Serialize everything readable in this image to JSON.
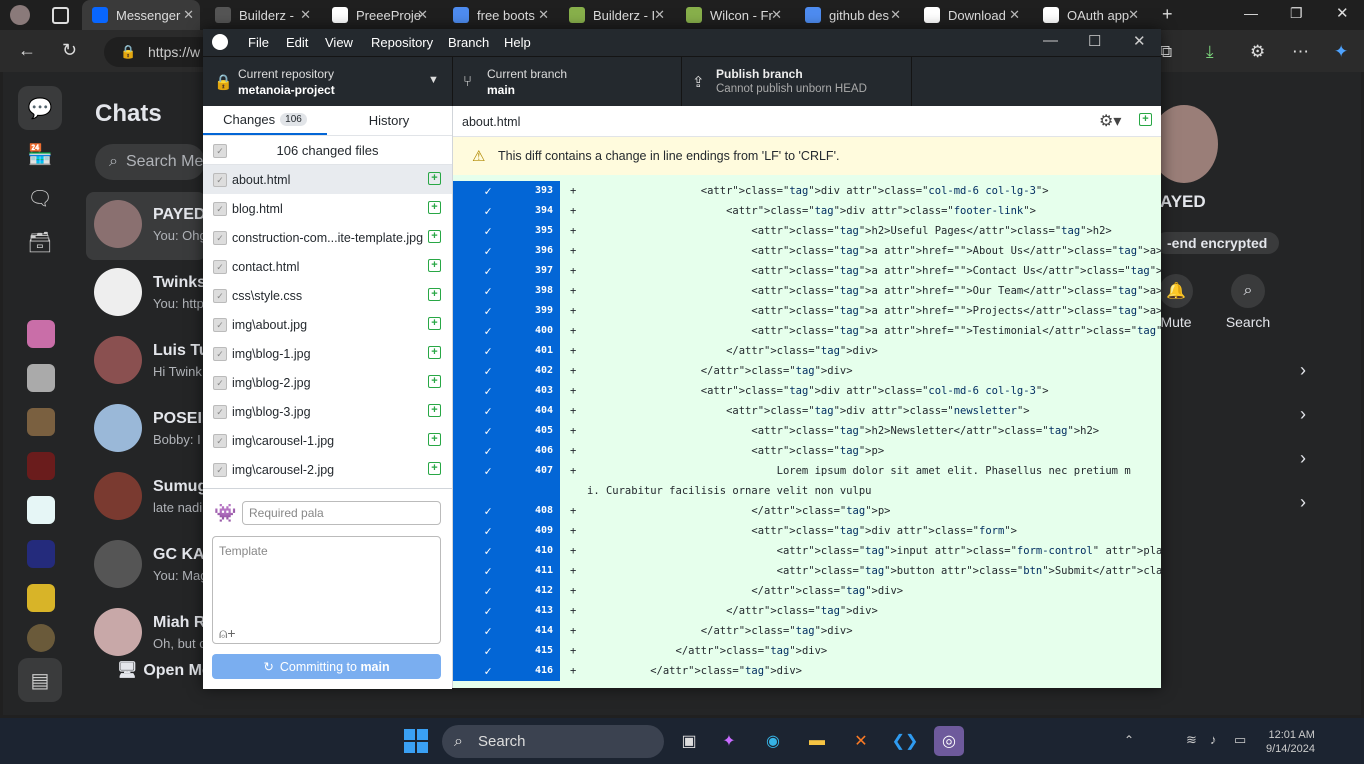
{
  "browser": {
    "tabs": [
      {
        "label": "Messenger",
        "active": true
      },
      {
        "label": "Builderz - "
      },
      {
        "label": "PreeeProje"
      },
      {
        "label": "free boots"
      },
      {
        "label": "Builderz - I"
      },
      {
        "label": "Wilcon - Fr"
      },
      {
        "label": "github des"
      },
      {
        "label": "Download"
      },
      {
        "label": "OAuth app"
      }
    ],
    "url": "https://w"
  },
  "messenger": {
    "title": "Chats",
    "search_placeholder": "Search Me",
    "chats": [
      {
        "name": "PAYED",
        "preview": "You: Ohg"
      },
      {
        "name": "Twinks",
        "preview": "You: http"
      },
      {
        "name": "Luis Tup",
        "preview": "Hi Twink"
      },
      {
        "name": "POSEID",
        "preview": "Bobby: I"
      },
      {
        "name": "Sumuga",
        "preview": "late nadi"
      },
      {
        "name": "GC KA S",
        "preview": "You: Mag"
      },
      {
        "name": "Miah Ra",
        "preview": "Oh, but c"
      }
    ],
    "open_label": "Open Me",
    "right_name": "AYED",
    "right_encrypted": "-end encrypted",
    "right_actions": [
      "Mute",
      "Search"
    ]
  },
  "ghd": {
    "menu": [
      "File",
      "Edit",
      "View",
      "Repository",
      "Branch",
      "Help"
    ],
    "repo_label": "Current repository",
    "repo_value": "metanoia-project",
    "branch_label": "Current branch",
    "branch_value": "main",
    "publish_label": "Publish branch",
    "publish_sub": "Cannot publish unborn HEAD",
    "tab_changes": "Changes",
    "tab_changes_count": "106",
    "tab_history": "History",
    "changed_files_label": "106 changed files",
    "files": [
      "about.html",
      "blog.html",
      "construction-com...ite-template.jpg",
      "contact.html",
      "css\\style.css",
      "img\\about.jpg",
      "img\\blog-1.jpg",
      "img\\blog-2.jpg",
      "img\\blog-3.jpg",
      "img\\carousel-1.jpg",
      "img\\carousel-2.jpg"
    ],
    "summary_placeholder": "Required pala",
    "description_placeholder": "Template",
    "commit_label": "Committing to",
    "commit_branch": "main",
    "diff_file": "about.html",
    "warning": "This diff contains a change in line endings from 'LF' to 'CRLF'.",
    "diff_lines": [
      {
        "n": "393",
        "code": "                  <div class=\"col-md-6 col-lg-3\">"
      },
      {
        "n": "394",
        "code": "                      <div class=\"footer-link\">"
      },
      {
        "n": "395",
        "code": "                          <h2>Useful Pages</h2>"
      },
      {
        "n": "396",
        "code": "                          <a href=\"\">About Us</a>"
      },
      {
        "n": "397",
        "code": "                          <a href=\"\">Contact Us</a>"
      },
      {
        "n": "398",
        "code": "                          <a href=\"\">Our Team</a>"
      },
      {
        "n": "399",
        "code": "                          <a href=\"\">Projects</a>"
      },
      {
        "n": "400",
        "code": "                          <a href=\"\">Testimonial</a>"
      },
      {
        "n": "401",
        "code": "                      </div>"
      },
      {
        "n": "402",
        "code": "                  </div>"
      },
      {
        "n": "403",
        "code": "                  <div class=\"col-md-6 col-lg-3\">"
      },
      {
        "n": "404",
        "code": "                      <div class=\"newsletter\">"
      },
      {
        "n": "405",
        "code": "                          <h2>Newsletter</h2>"
      },
      {
        "n": "406",
        "code": "                          <p>"
      },
      {
        "n": "407",
        "code": "                              Lorem ipsum dolor sit amet elit. Phasellus nec pretium m"
      },
      {
        "n": "",
        "code": "i. Curabitur facilisis ornare velit non vulpu",
        "wrap": true
      },
      {
        "n": "408",
        "code": "                          </p>"
      },
      {
        "n": "409",
        "code": "                          <div class=\"form\">"
      },
      {
        "n": "410",
        "code": "                              <input class=\"form-control\" placeholder=\"Email here\">"
      },
      {
        "n": "411",
        "code": "                              <button class=\"btn\">Submit</button>"
      },
      {
        "n": "412",
        "code": "                          </div>"
      },
      {
        "n": "413",
        "code": "                      </div>"
      },
      {
        "n": "414",
        "code": "                  </div>"
      },
      {
        "n": "415",
        "code": "              </div>"
      },
      {
        "n": "416",
        "code": "          </div>"
      }
    ]
  },
  "taskbar": {
    "search_label": "Search",
    "time": "12:01 AM",
    "date": "9/14/2024"
  },
  "colors": {
    "ghd_dark": "#24292e",
    "diff_added_bg": "#e6ffec",
    "line_gutter": "#0366d6",
    "warning_bg": "#fffbdd"
  }
}
